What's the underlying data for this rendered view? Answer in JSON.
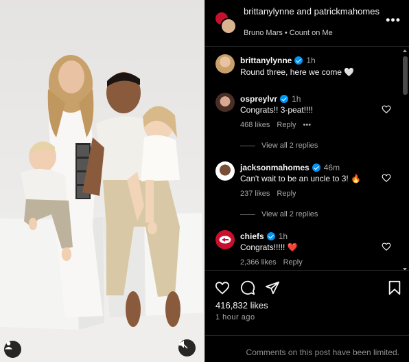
{
  "photo": {
    "caption_hint": "",
    "avatar_icon": "person-icon",
    "mute_icon": "speaker-muted-icon"
  },
  "header": {
    "names": "brittanylynne and patrickmahomes",
    "song_artist": "Bruno Mars",
    "song_title": "Count on Me",
    "separator": "•",
    "more_label": "•••"
  },
  "comments": [
    {
      "username": "brittanylynne",
      "verified": true,
      "time": "1h",
      "text": "Round three, here we come 🤍",
      "meta": []
    },
    {
      "username": "ospreylvr",
      "verified": true,
      "time": "1h",
      "text": "Congrats!! 3-peat!!!!",
      "likes": "468 likes",
      "reply": "Reply",
      "more": "•••",
      "view_replies": "View all 2 replies"
    },
    {
      "username": "jacksonmahomes",
      "verified": true,
      "time": "46m",
      "text": "Can't wait to be an uncle to 3! 🔥",
      "likes": "237 likes",
      "reply": "Reply",
      "view_replies": "View all 2 replies"
    },
    {
      "username": "chiefs",
      "verified": true,
      "time": "1h",
      "text": "Congrats!!!!! ❤️",
      "likes": "2,366 likes",
      "reply": "Reply"
    }
  ],
  "actions": {
    "like_icon": "heart-icon",
    "comment_icon": "comment-icon",
    "share_icon": "send-icon",
    "save_icon": "bookmark-icon",
    "likes": "416,832 likes",
    "posted": "1 hour ago"
  },
  "footer": {
    "limited_text": "Comments on this post have been limited."
  },
  "colors": {
    "background": "#000000",
    "text": "#f5f5f5",
    "secondary": "#a8a8a8",
    "verified": "#0095f6",
    "chiefs_red": "#c8102e"
  }
}
